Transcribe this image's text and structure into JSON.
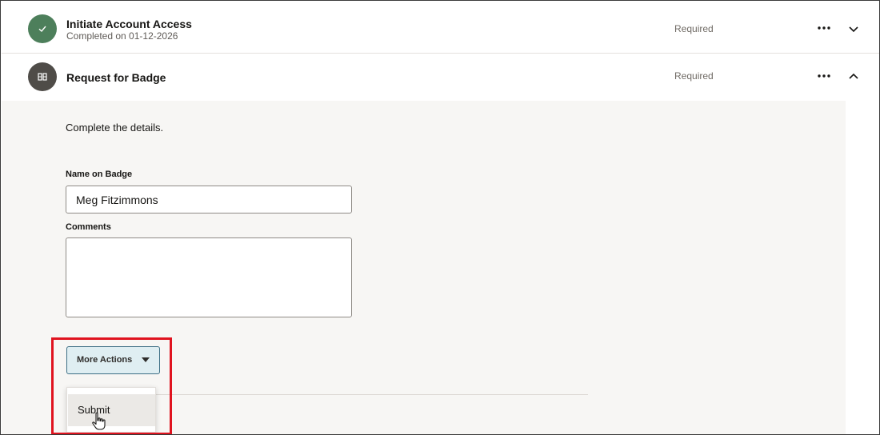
{
  "tasks": [
    {
      "title": "Initiate Account Access",
      "subtitle": "Completed on 01-12-2026",
      "status": "Required",
      "state_icon": "check-icon",
      "expand_icon": "chevron-down-icon"
    },
    {
      "title": "Request for Badge",
      "status": "Required",
      "state_icon": "badge-icon",
      "expand_icon": "chevron-up-icon"
    }
  ],
  "panel": {
    "instructions": "Complete the details.",
    "name_label": "Name on Badge",
    "name_value": "Meg Fitzimmons",
    "comments_label": "Comments",
    "comments_value": ""
  },
  "actions": {
    "more_label": "More Actions",
    "menu_items": [
      "Submit"
    ]
  },
  "colors": {
    "completed": "#4d7f5b",
    "in_progress": "#4f4c48",
    "button_bg": "#dfeef2",
    "highlight": "#e0131f"
  }
}
